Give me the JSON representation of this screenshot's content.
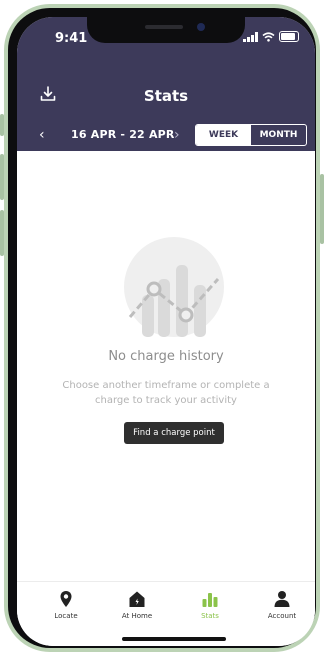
{
  "status_bar": {
    "time": "9:41"
  },
  "header": {
    "title": "Stats",
    "download_icon": "download-icon",
    "date_range": "16 APR - 22 APR",
    "prev_icon": "‹",
    "next_icon": "›",
    "toggle": {
      "week_label": "WEEK",
      "month_label": "MONTH",
      "selected": "WEEK"
    }
  },
  "empty_state": {
    "title": "No charge history",
    "description": "Choose another timeframe or complete a charge to track your activity",
    "button_label": "Find a charge point"
  },
  "tabs": [
    {
      "label": "Locate",
      "icon": "location-pin-icon",
      "active": false
    },
    {
      "label": "At Home",
      "icon": "home-icon",
      "active": false
    },
    {
      "label": "Stats",
      "icon": "bar-chart-icon",
      "active": true
    },
    {
      "label": "Account",
      "icon": "person-icon",
      "active": false
    }
  ],
  "colors": {
    "header_bg": "#3d3a5a",
    "accent": "#8bc34a",
    "frame": "#bcd3b5",
    "button_bg": "#2f2f2f"
  }
}
